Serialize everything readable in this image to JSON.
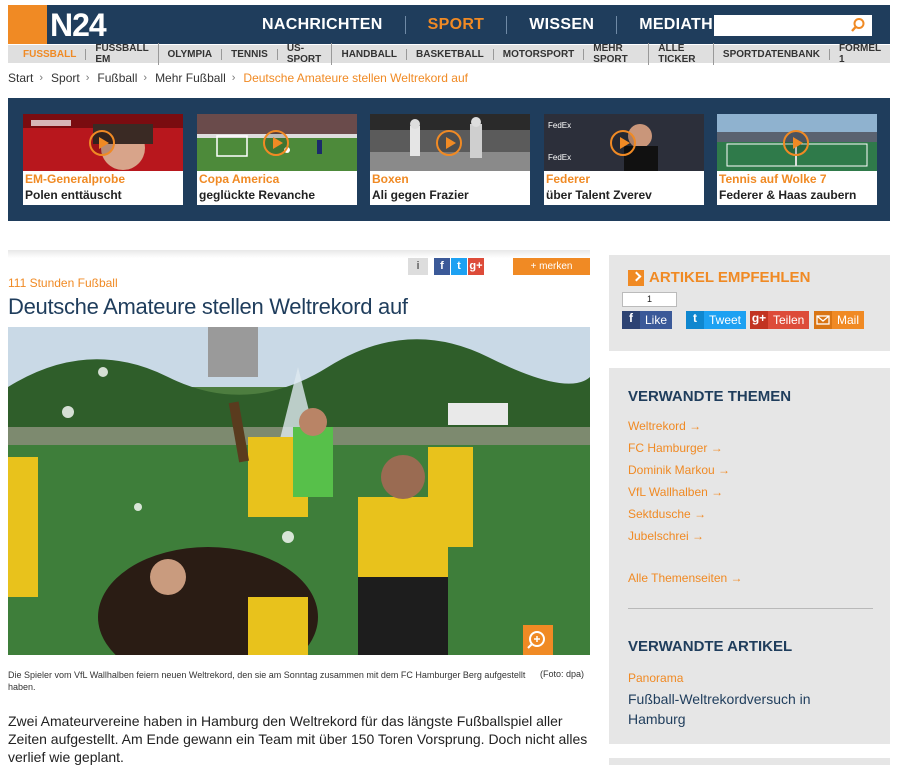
{
  "header": {
    "logo": "N24",
    "nav": [
      "NACHRICHTEN",
      "SPORT",
      "WISSEN",
      "MEDIATHEK"
    ],
    "active_nav": "SPORT",
    "search_placeholder": ""
  },
  "subnav": [
    "FUSSBALL",
    "FUSSBALL EM",
    "OLYMPIA",
    "TENNIS",
    "US-SPORT",
    "HANDBALL",
    "BASKETBALL",
    "MOTORSPORT",
    "MEHR SPORT",
    "ALLE TICKER",
    "SPORTDATENBANK",
    "FORMEL 1"
  ],
  "breadcrumb": [
    "Start",
    "Sport",
    "Fußball",
    "Mehr Fußball",
    "Deutsche Amateure stellen Weltrekord auf"
  ],
  "teasers": [
    {
      "kicker": "EM-Generalprobe",
      "title": "Polen enttäuscht"
    },
    {
      "kicker": "Copa America",
      "title": "geglückte Revanche"
    },
    {
      "kicker": "Boxen",
      "title": "Ali gegen Frazier"
    },
    {
      "kicker": "Federer",
      "title": "über Talent Zverev"
    },
    {
      "kicker": "Tennis auf Wolke 7",
      "title": "Federer & Haas zaubern"
    }
  ],
  "article": {
    "info": "i",
    "merken": "+ merken",
    "kicker": "111 Stunden Fußball",
    "headline": "Deutsche Amateure stellen Weltrekord auf",
    "caption": "Die Spieler vom VfL Wallhalben feiern neuen Weltrekord, den sie am Sonntag zusammen mit dem FC Hamburger Berg aufgestellt haben.",
    "credit": "(Foto: dpa)",
    "lead": "Zwei Amateurvereine haben in Hamburg den Weltrekord für das längste Fußballspiel aller Zeiten aufgestellt. Am Ende gewann ein Team mit über 150 Toren Vorsprung. Doch nicht alles verlief wie geplant."
  },
  "recommend": {
    "title": "ARTIKEL EMPFEHLEN",
    "fb_count": "1",
    "buttons": [
      {
        "label": "Like",
        "icon": "f",
        "color": "#3b5998"
      },
      {
        "label": "Tweet",
        "icon": "t",
        "color": "#1da1f2"
      },
      {
        "label": "Teilen",
        "icon": "g+",
        "color": "#dd4b39"
      },
      {
        "label": "Mail",
        "icon": "mail",
        "color": "#f08a24"
      }
    ]
  },
  "themen": {
    "title": "VERWANDTE THEMEN",
    "links": [
      "Weltrekord",
      "FC Hamburger",
      "Dominik Markou",
      "VfL Wallhalben",
      "Sektdusche",
      "Jubelschrei"
    ],
    "all_link": "Alle Themenseiten"
  },
  "related": {
    "title": "VERWANDTE ARTIKEL",
    "kicker": "Panorama",
    "headline": "Fußball-Weltrekordversuch in Hamburg"
  },
  "colors": {
    "accent": "#f08a24",
    "navy": "#1f3d5c"
  }
}
